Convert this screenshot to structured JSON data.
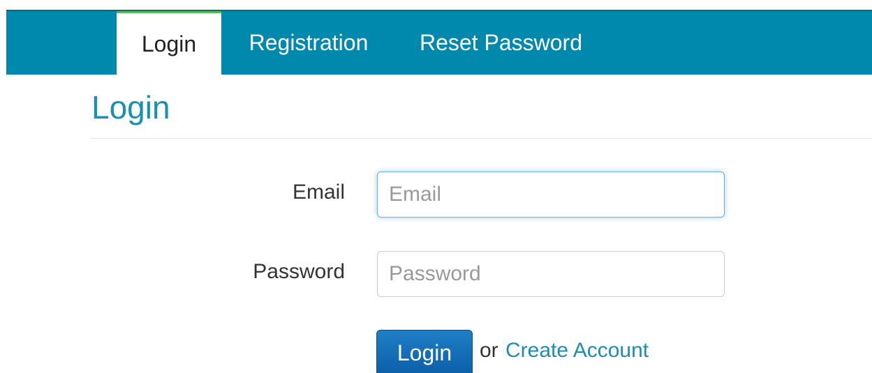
{
  "nav": {
    "tabs": [
      {
        "label": "Login",
        "active": true
      },
      {
        "label": "Registration",
        "active": false
      },
      {
        "label": "Reset Password",
        "active": false
      }
    ]
  },
  "page": {
    "title": "Login"
  },
  "form": {
    "email_label": "Email",
    "email_placeholder": "Email",
    "email_value": "",
    "password_label": "Password",
    "password_placeholder": "Password",
    "password_value": "",
    "login_button": "Login",
    "or_text": "or",
    "create_account_link": "Create Account"
  },
  "colors": {
    "navbar_bg": "#0089ad",
    "accent_text": "#1b8fb2",
    "active_tab_border": "#5cb85c",
    "button_bg": "#0b5ca6"
  }
}
